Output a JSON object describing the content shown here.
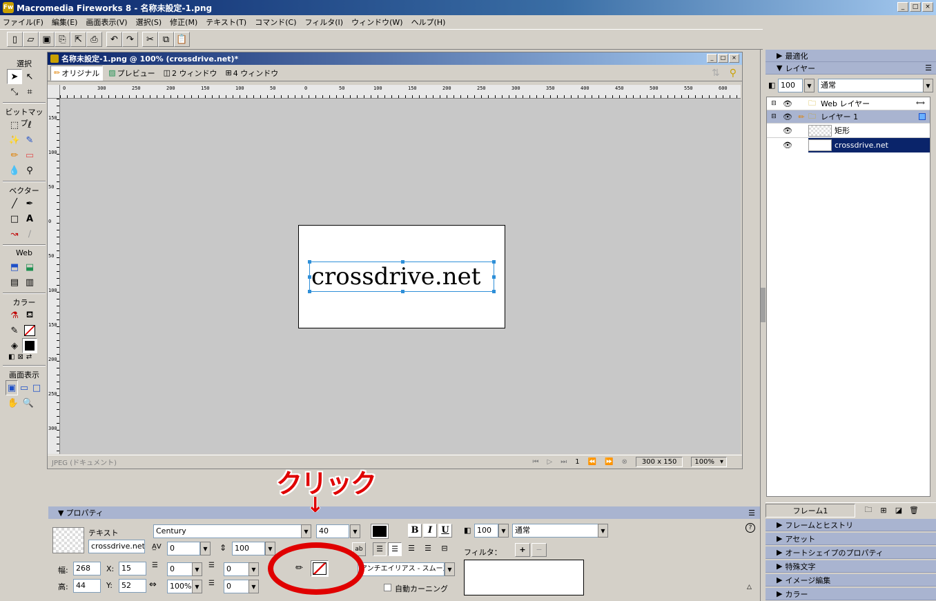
{
  "app": {
    "title": "Macromedia Fireworks 8 - 名称未設定-1.png",
    "win_buttons": [
      "_",
      "□",
      "×"
    ]
  },
  "menu": [
    "ファイル(F)",
    "編集(E)",
    "画面表示(V)",
    "選択(S)",
    "修正(M)",
    "テキスト(T)",
    "コマンド(C)",
    "フィルタ(I)",
    "ウィンドウ(W)",
    "ヘルプ(H)"
  ],
  "toolbar_icons": [
    "new-icon",
    "open-icon",
    "save-icon",
    "import-icon",
    "export-icon",
    "print-icon",
    "undo-icon",
    "redo-icon",
    "cut-icon",
    "copy-icon",
    "paste-icon"
  ],
  "tools": {
    "sections": [
      "選択",
      "ビットマップ",
      "ベクター",
      "Web",
      "カラー",
      "画面表示"
    ]
  },
  "document": {
    "title": "名称未設定-1.png @ 100% (crossdrive.net)*",
    "tabs": [
      "オリジナル",
      "プレビュー",
      "2 ウィンドウ",
      "4 ウィンドウ"
    ],
    "ruler_h": [
      "0",
      "300",
      "250",
      "200",
      "150",
      "100",
      "50",
      "0",
      "50",
      "100",
      "150",
      "200",
      "250",
      "300",
      "350",
      "400",
      "450",
      "500",
      "550",
      "600"
    ],
    "ruler_v": [
      "150",
      "100",
      "50",
      "0",
      "50",
      "100",
      "150",
      "200",
      "250",
      "300"
    ],
    "canvas_text": "crossdrive.net",
    "status_left": "JPEG (ドキュメント)",
    "frame": "1",
    "size": "300 x 150",
    "zoom": "100%"
  },
  "annotation": {
    "text": "クリック",
    "arrow": "↓",
    "color": "#e00000"
  },
  "properties": {
    "title": "プロパティ",
    "type_label": "テキスト",
    "object_name": "crossdrive.net",
    "font": "Century",
    "font_size": "40",
    "bold": "B",
    "italic": "I",
    "underline": "U",
    "kerning": "0",
    "leading": "100",
    "indent": "0",
    "space_before": "0",
    "space_after": "0",
    "horiz_scale": "100%",
    "antialias": "アンチエイリアス - スムーズ",
    "auto_kerning": "自動カーニング",
    "opacity": "100",
    "blend": "通常",
    "filter_label": "フィルタ：",
    "w_label": "幅:",
    "w": "268",
    "h_label": "高:",
    "h": "44",
    "x_label": "X:",
    "x": "15",
    "y_label": "Y:",
    "y": "52",
    "help": "?"
  },
  "layers_panel": {
    "optimize": "最適化",
    "title": "レイヤー",
    "opacity": "100",
    "blend": "通常",
    "rows": [
      {
        "name": "Web レイヤー",
        "type": "folder"
      },
      {
        "name": "レイヤー 1",
        "type": "folder"
      },
      {
        "name": "矩形",
        "type": "object"
      },
      {
        "name": "crossdrive.net",
        "type": "object"
      }
    ],
    "frame_label": "フレーム1"
  },
  "collapsed_panels": [
    "フレームとヒストリ",
    "アセット",
    "オートシェイプのプロパティ",
    "特殊文字",
    "イメージ編集",
    "カラー"
  ]
}
